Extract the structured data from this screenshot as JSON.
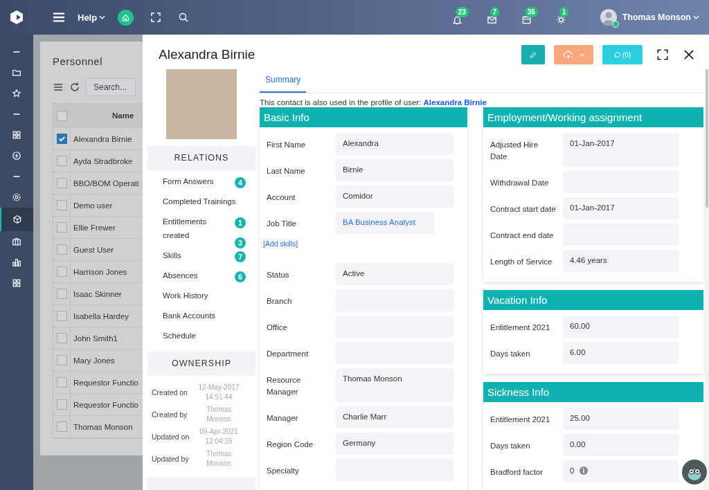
{
  "topbar": {
    "help_menu": "Help",
    "notifications": [
      {
        "kind": "bell",
        "count": "23"
      },
      {
        "kind": "mail",
        "count": "7"
      },
      {
        "kind": "calendar",
        "count": "36"
      },
      {
        "kind": "sun",
        "count": "1"
      }
    ],
    "user": {
      "name": "Thomas Monson",
      "online": true
    }
  },
  "sidebar": {
    "items": [
      {
        "kind": "dash",
        "selected": false
      },
      {
        "kind": "folder",
        "selected": false
      },
      {
        "kind": "star",
        "selected": false
      },
      {
        "kind": "dash",
        "selected": false
      },
      {
        "kind": "grid",
        "selected": false
      },
      {
        "kind": "plus",
        "selected": false
      },
      {
        "kind": "dash",
        "selected": false
      },
      {
        "kind": "gear",
        "selected": false
      },
      {
        "kind": "cube",
        "selected": true
      },
      {
        "kind": "briefcase",
        "selected": false
      },
      {
        "kind": "chart",
        "selected": false
      },
      {
        "kind": "grid",
        "selected": false
      }
    ]
  },
  "personnel": {
    "title": "Personnel",
    "search": {
      "placeholder": "Search..."
    },
    "all_selected": false,
    "columns": [
      "Name"
    ],
    "rows": [
      {
        "name": "Alexandra Birnie",
        "selected": true
      },
      {
        "name": "Ayda Stradbroke",
        "selected": false
      },
      {
        "name": "BBO/BOM Operati",
        "selected": false
      },
      {
        "name": "Demo user",
        "selected": false
      },
      {
        "name": "Ellie Frewer",
        "selected": false
      },
      {
        "name": "Guest User",
        "selected": false
      },
      {
        "name": "Harrison Jones",
        "selected": false
      },
      {
        "name": "Isaac Skinner",
        "selected": false
      },
      {
        "name": "Isabella Hardey",
        "selected": false
      },
      {
        "name": "John Smith1",
        "selected": false
      },
      {
        "name": "Mary Jones",
        "selected": false
      },
      {
        "name": "Requestor Functio",
        "selected": false
      },
      {
        "name": "Requestor Functio",
        "selected": false
      },
      {
        "name": "Thomas Monson",
        "selected": false
      }
    ]
  },
  "detail": {
    "title": "Alexandra Birnie",
    "comment_button": "(0)",
    "relations": {
      "title": "RELATIONS",
      "items": [
        {
          "label": "Form Answers",
          "badges": [
            "4"
          ]
        },
        {
          "label": "Completed Trainings"
        },
        {
          "label": "Entitlements created",
          "badges": [
            "1",
            "3"
          ]
        },
        {
          "label": "Skills",
          "badges": [
            "7"
          ]
        },
        {
          "label": "Absences",
          "badges": [
            "6"
          ]
        },
        {
          "label": "Work History"
        },
        {
          "label": "Bank Accounts"
        },
        {
          "label": "Schedule"
        }
      ]
    },
    "ownership": {
      "title": "OWNERSHIP",
      "items": [
        {
          "label": "Created on",
          "value": "12-May-2017 14:51:44"
        },
        {
          "label": "Created by",
          "value": "Thomas Monson"
        },
        {
          "label": "Updated on",
          "value": "09-Apr-2021 12:04:35"
        },
        {
          "label": "Updated by",
          "value": "Thomas Monson"
        }
      ]
    },
    "tabs": [
      {
        "label": "Summary",
        "selected": true
      }
    ],
    "note": {
      "text": "This contact is also used in the profile of user:",
      "link": "Alexandra Birnie"
    },
    "basic_info": {
      "title": "Basic Info",
      "fields": [
        {
          "kind": "text",
          "label": "First Name",
          "value": "Alexandra"
        },
        {
          "kind": "text",
          "label": "Last Name",
          "value": "Birnie"
        },
        {
          "kind": "text",
          "label": "Account",
          "value": "Comidor"
        },
        {
          "kind": "link",
          "label": "Job Title",
          "value": "BA Business Analyst"
        },
        {
          "kind": "action",
          "label": "[Add skills]"
        },
        {
          "kind": "text",
          "label": "Status",
          "value": "Active"
        },
        {
          "kind": "text",
          "label": "Branch"
        },
        {
          "kind": "text",
          "label": "Office"
        },
        {
          "kind": "text",
          "label": "Department"
        },
        {
          "kind": "text",
          "label": "Resource Manager",
          "value": "Thomas Monson"
        },
        {
          "kind": "text",
          "label": "Manager",
          "value": "Charlie Marr"
        },
        {
          "kind": "text",
          "label": "Region Code",
          "value": "Germany"
        },
        {
          "kind": "text",
          "label": "Specialty"
        }
      ]
    },
    "sections": [
      {
        "title": "Employment/Working assignment",
        "fields": [
          {
            "kind": "text",
            "label": "Adjusted Hire Date",
            "value": "01-Jan-2017"
          },
          {
            "kind": "text",
            "label": "Withdrawal Date"
          },
          {
            "kind": "text",
            "label": "Contract start date",
            "value": "01-Jan-2017"
          },
          {
            "kind": "text",
            "label": "Contract end date"
          },
          {
            "kind": "text",
            "label": "Length of Service",
            "value": "4.46 years"
          }
        ]
      },
      {
        "title": "Vacation Info",
        "fields": [
          {
            "kind": "text",
            "label": "Entitlement 2021",
            "value": "60.00"
          },
          {
            "kind": "text",
            "label": "Days taken",
            "value": "6.00"
          }
        ]
      },
      {
        "title": "Sickness Info",
        "fields": [
          {
            "kind": "text",
            "label": "Entitlement 2021",
            "value": "25.00"
          },
          {
            "kind": "text",
            "label": "Days taken",
            "value": "0.00"
          },
          {
            "kind": "info",
            "label": "Bradford factor",
            "value": "0"
          }
        ]
      }
    ]
  }
}
